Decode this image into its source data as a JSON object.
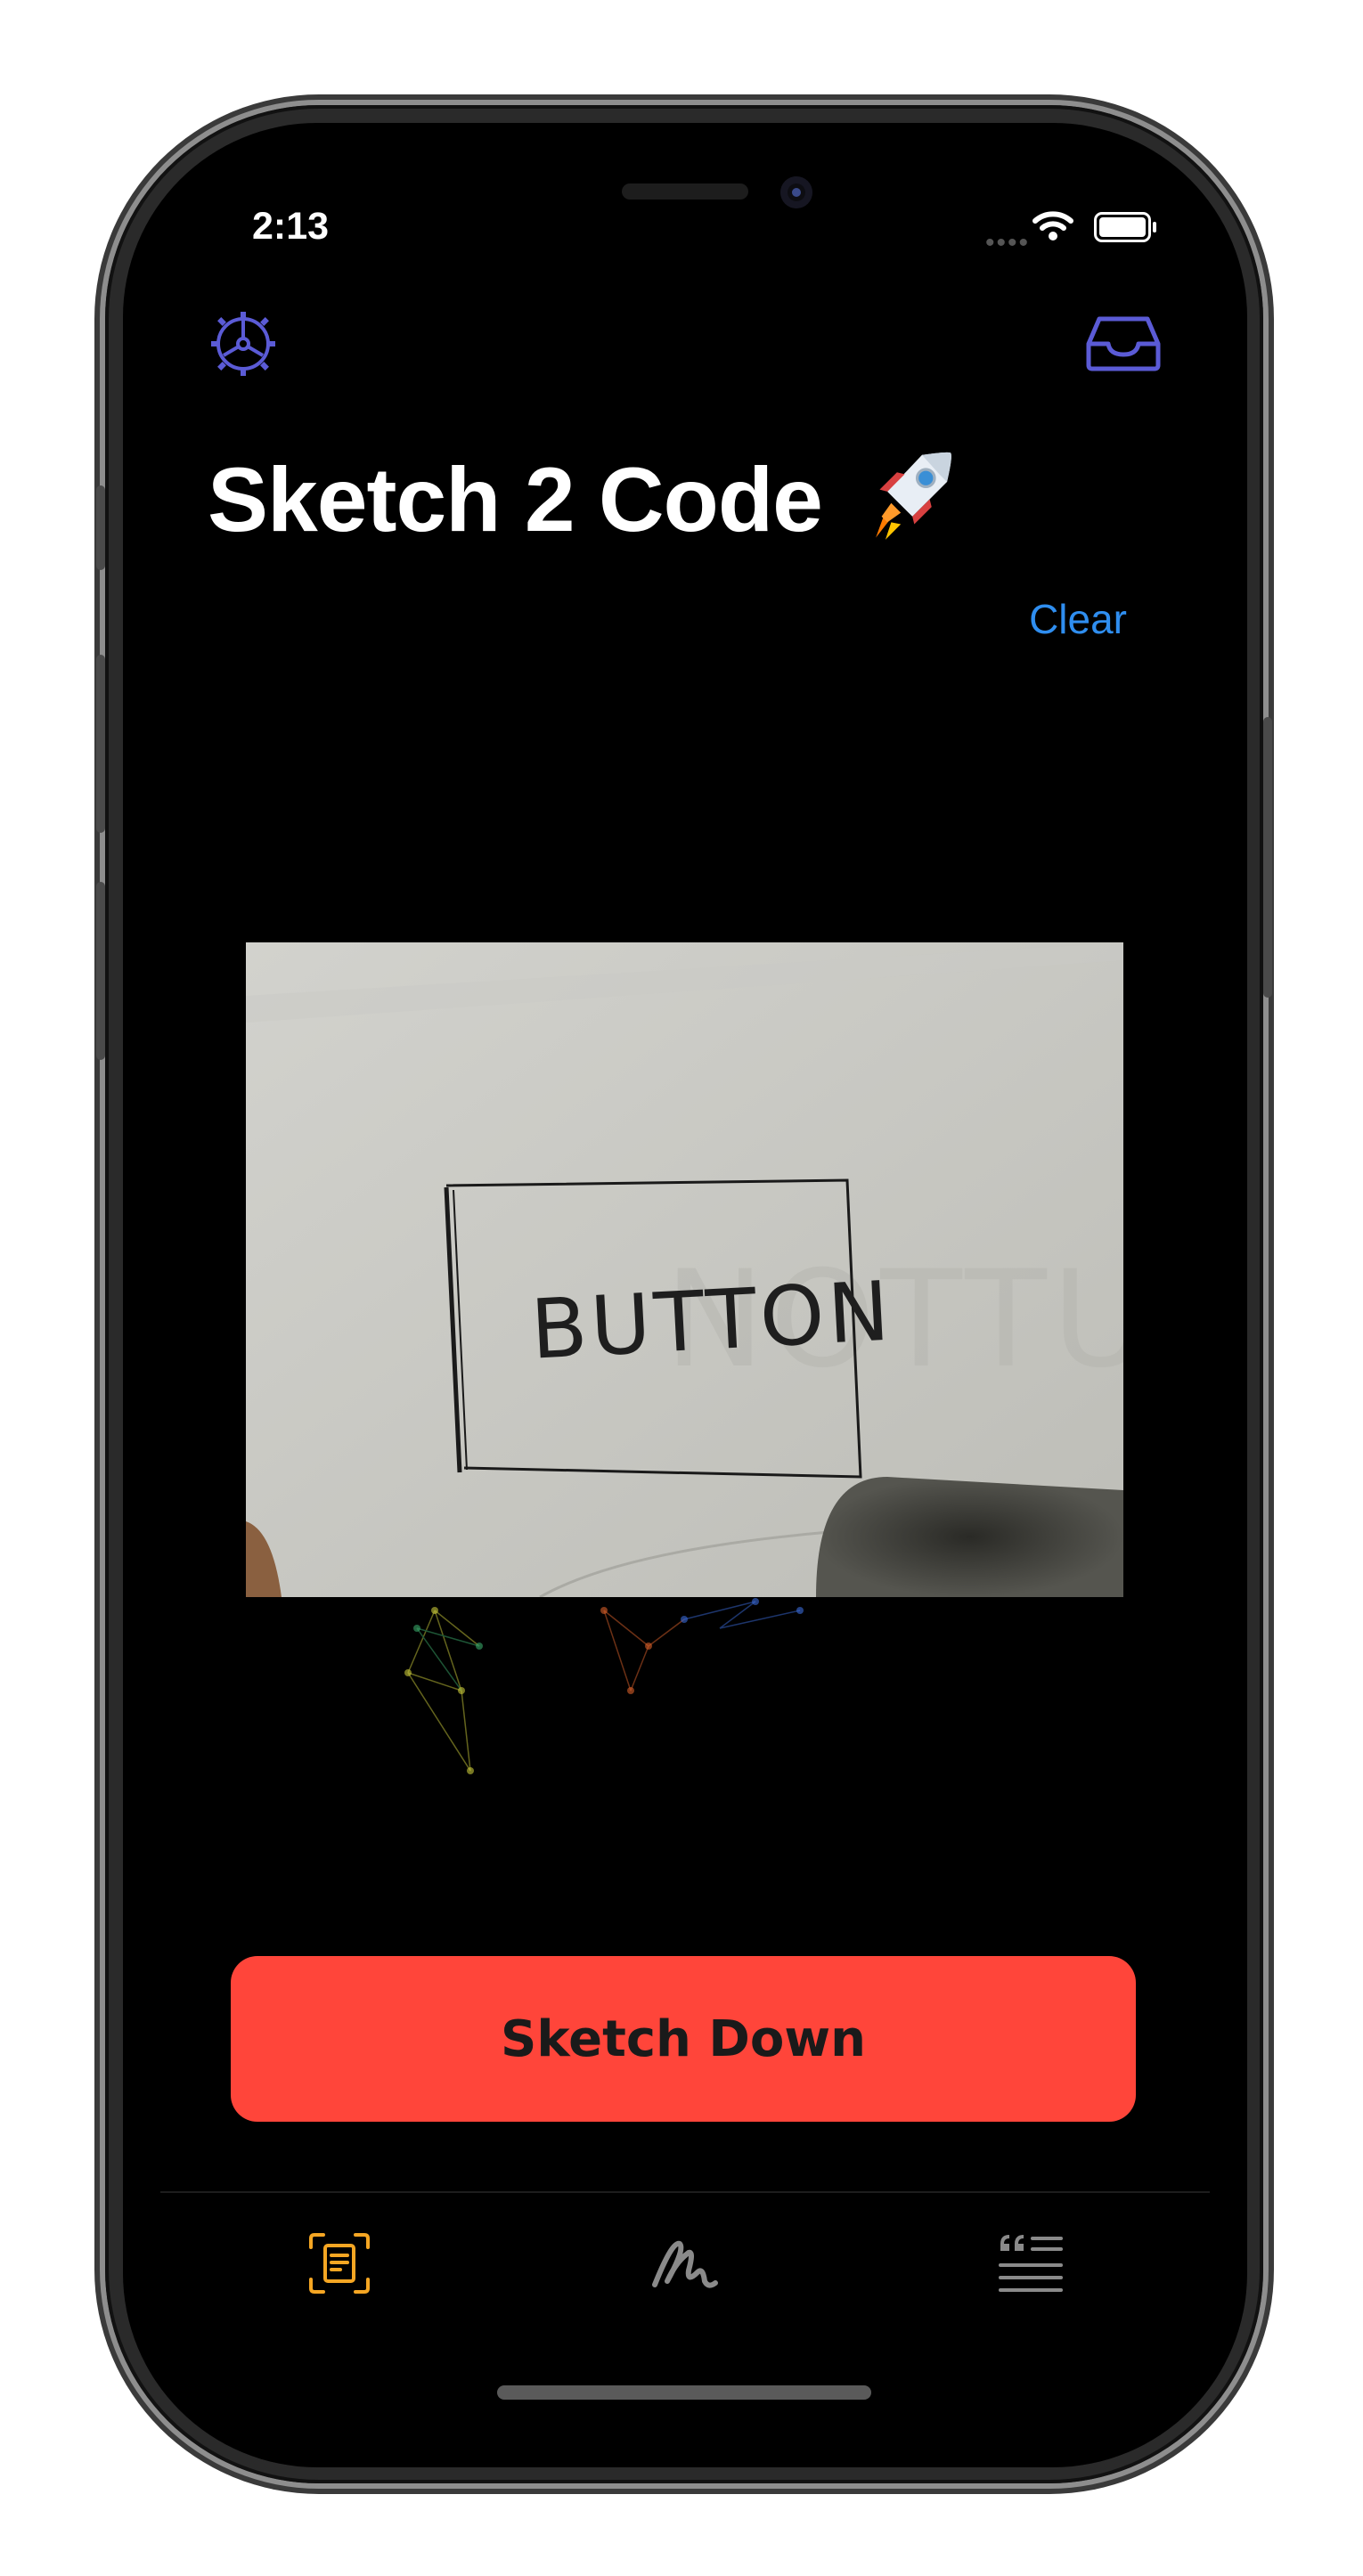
{
  "status_bar": {
    "time": "2:13"
  },
  "nav": {
    "settings_icon": "gear-icon",
    "inbox_icon": "tray-icon"
  },
  "header": {
    "title": "Sketch 2 Code",
    "title_emoji": "rocket-emoji"
  },
  "actions": {
    "clear_label": "Clear"
  },
  "preview": {
    "sketch_text": "BUTTON"
  },
  "primary_button": {
    "label": "Sketch Down"
  },
  "tab_bar": {
    "items": [
      {
        "icon": "document-scan-icon",
        "selected": true,
        "color": "#f5a623"
      },
      {
        "icon": "scribble-icon",
        "selected": false,
        "color": "#8a8a8a"
      },
      {
        "icon": "quote-list-icon",
        "selected": false,
        "color": "#8a8a8a"
      }
    ]
  },
  "colors": {
    "accent": "#5b5bd6",
    "link": "#2f8ef0",
    "button": "#ff453a",
    "background": "#000000"
  }
}
